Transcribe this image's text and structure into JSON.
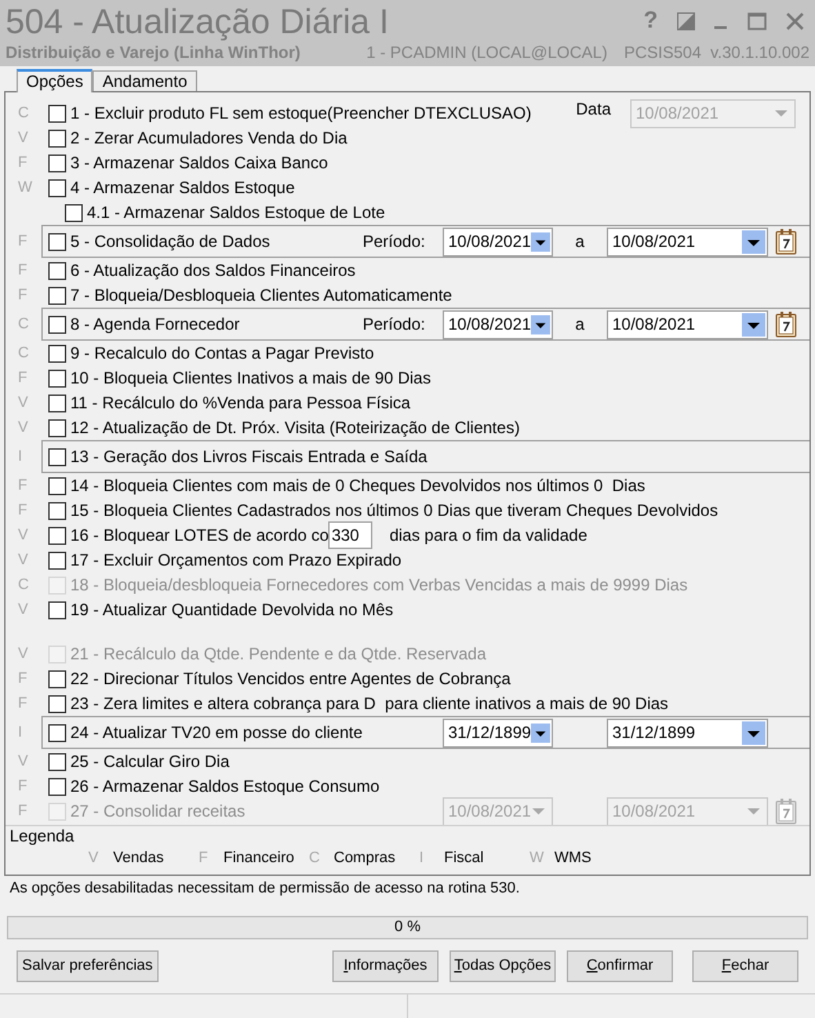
{
  "window": {
    "title": "504 - Atualização Diária I",
    "subtitle": "Distribuição e Varejo (Linha WinThor)",
    "user": "1 - PCADMIN (LOCAL@LOCAL)",
    "version": "PCSIS504  v.30.1.10.002",
    "help_button": "?"
  },
  "tabs": [
    {
      "label": "Opções",
      "selected": true
    },
    {
      "label": "Andamento",
      "selected": false
    }
  ],
  "options": [
    {
      "kind": "date",
      "category": "C",
      "label": "1 - Excluir produto FL sem estoque(Preencher DTEXCLUSAO)",
      "checked": false,
      "disabled": false,
      "framed": false,
      "date_label": "Data",
      "date": {
        "value": "10/08/2021",
        "disabled": true
      }
    },
    {
      "kind": "plain",
      "category": "V",
      "label": "2 - Zerar Acumuladores Venda do Dia",
      "checked": false,
      "disabled": false,
      "framed": false
    },
    {
      "kind": "plain",
      "category": "F",
      "label": "3 - Armazenar Saldos Caixa Banco",
      "checked": false,
      "disabled": false,
      "framed": false
    },
    {
      "kind": "plain",
      "category": "W",
      "label": "4 - Armazenar Saldos Estoque",
      "checked": false,
      "disabled": false,
      "framed": false,
      "children": [
        {
          "label": "4.1 - Armazenar Saldos Estoque de Lote",
          "checked": false,
          "disabled": false,
          "framed": false
        }
      ]
    },
    {
      "kind": "period",
      "category": "F",
      "label": "5 - Consolidação de Dados",
      "checked": false,
      "disabled": false,
      "framed": true,
      "period_label": "Período:",
      "from": {
        "value": "10/08/2021",
        "disabled": false
      },
      "separator": "a",
      "to": {
        "value": "10/08/2021",
        "disabled": false
      },
      "calendar": true
    },
    {
      "kind": "plain",
      "category": "F",
      "label": "6 - Atualização dos Saldos Financeiros",
      "checked": false,
      "disabled": false,
      "framed": false
    },
    {
      "kind": "plain",
      "category": "F",
      "label": "7 - Bloqueia/Desbloqueia Clientes Automaticamente",
      "checked": false,
      "disabled": false,
      "framed": false
    },
    {
      "kind": "period",
      "category": "C",
      "label": "8 - Agenda Fornecedor",
      "checked": false,
      "disabled": false,
      "framed": true,
      "period_label": "Período:",
      "from": {
        "value": "10/08/2021",
        "disabled": false
      },
      "separator": "a",
      "to": {
        "value": "10/08/2021",
        "disabled": false
      },
      "calendar": true
    },
    {
      "kind": "plain",
      "category": "C",
      "label": "9 - Recalculo do Contas a Pagar Previsto",
      "checked": false,
      "disabled": false,
      "framed": false
    },
    {
      "kind": "plain",
      "category": "F",
      "label": "10 - Bloqueia Clientes Inativos a mais de 90 Dias",
      "checked": false,
      "disabled": false,
      "framed": false
    },
    {
      "kind": "plain",
      "category": "V",
      "label": "11 - Recálculo do %Venda para Pessoa Física",
      "checked": false,
      "disabled": false,
      "framed": false
    },
    {
      "kind": "plain",
      "category": "V",
      "label": "12 - Atualização de Dt. Próx. Visita (Roteirização de Clientes)",
      "checked": false,
      "disabled": false,
      "framed": false
    },
    {
      "kind": "plain",
      "category": "I",
      "label": "13 - Geração dos Livros Fiscais Entrada e Saída",
      "checked": false,
      "disabled": false,
      "framed": true
    },
    {
      "kind": "plain",
      "category": "F",
      "label": "14 - Bloqueia Clientes com mais de 0 Cheques Devolvidos nos últimos 0  Dias",
      "checked": false,
      "disabled": false,
      "framed": false
    },
    {
      "kind": "plain",
      "category": "F",
      "label": "15 - Bloqueia Clientes Cadastrados nos últimos 0 Dias que tiveram Cheques Devolvidos",
      "checked": false,
      "disabled": false,
      "framed": false
    },
    {
      "kind": "qty",
      "category": "V",
      "label": "16 - Bloquear LOTES de acordo co",
      "checked": false,
      "disabled": false,
      "framed": false,
      "value": "330",
      "suffix": "dias para o fim da validade"
    },
    {
      "kind": "plain",
      "category": "V",
      "label": "17 - Excluir Orçamentos com Prazo Expirado",
      "checked": false,
      "disabled": false,
      "framed": false
    },
    {
      "kind": "plain",
      "category": "C",
      "label": "18 - Bloqueia/desbloqueia Fornecedores com Verbas Vencidas a mais de 9999 Dias",
      "checked": false,
      "disabled": true,
      "framed": false
    },
    {
      "kind": "plain",
      "category": "V",
      "label": "19 - Atualizar Quantidade Devolvida no Mês",
      "checked": false,
      "disabled": false,
      "framed": false
    }
  ],
  "options_lower": [
    {
      "kind": "plain",
      "category": "V",
      "label": "21 - Recálculo da Qtde. Pendente e da Qtde. Reservada",
      "checked": false,
      "disabled": true,
      "framed": false
    },
    {
      "kind": "plain",
      "category": "F",
      "label": "22 - Direcionar Títulos Vencidos entre Agentes de Cobrança",
      "checked": false,
      "disabled": false,
      "framed": false
    },
    {
      "kind": "plain",
      "category": "F",
      "label": "23 - Zera limites e altera cobrança para D  para cliente inativos a mais de 90 Dias",
      "checked": false,
      "disabled": false,
      "framed": false
    },
    {
      "kind": "period",
      "category": "I",
      "label": "24 - Atualizar TV20 em posse do cliente",
      "checked": false,
      "disabled": false,
      "framed": true,
      "from": {
        "value": "31/12/1899",
        "disabled": false
      },
      "to": {
        "value": "31/12/1899",
        "disabled": false
      },
      "calendar": false
    },
    {
      "kind": "plain",
      "category": "V",
      "label": "25 - Calcular Giro Dia",
      "checked": false,
      "disabled": false,
      "framed": false
    },
    {
      "kind": "plain",
      "category": "F",
      "label": "26 - Armazenar Saldos Estoque Consumo",
      "checked": false,
      "disabled": false,
      "framed": false
    },
    {
      "kind": "period",
      "category": "F",
      "label": "27 - Consolidar receitas",
      "checked": false,
      "disabled": true,
      "framed": false,
      "from": {
        "value": "10/08/2021",
        "disabled": true
      },
      "to": {
        "value": "10/08/2021",
        "disabled": true
      },
      "calendar": true
    }
  ],
  "legend": {
    "title": "Legenda",
    "items": [
      {
        "letter": "V",
        "label": "Vendas"
      },
      {
        "letter": "F",
        "label": "Financeiro"
      },
      {
        "letter": "C",
        "label": "Compras"
      },
      {
        "letter": "I",
        "label": "Fiscal"
      },
      {
        "letter": "W",
        "label": "WMS"
      }
    ]
  },
  "notice": "As opções desabilitadas necessitam de permissão de acesso na rotina 530.",
  "progress": {
    "level": 0,
    "text": "0 %"
  },
  "preferences_button": {
    "label": "Salvar preferências",
    "underline_first": false
  },
  "buttons": [
    {
      "label": "Informações",
      "underline_first": true
    },
    {
      "label": "Todas Opções",
      "underline_first": true
    },
    {
      "label": "Confirmar",
      "underline_first": true
    },
    {
      "label": "Fechar",
      "underline_first": true
    }
  ]
}
